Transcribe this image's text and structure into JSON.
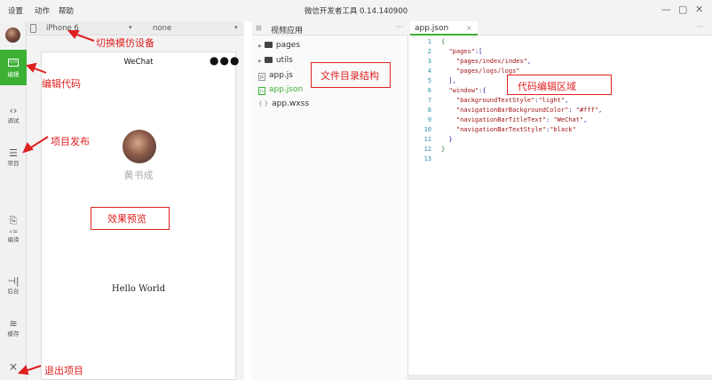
{
  "titlebar": {
    "menus": [
      "设置",
      "动作",
      "帮助"
    ],
    "title": "微信开发者工具 0.14.140900",
    "controls": [
      "minimize-icon",
      "restore-icon",
      "close-icon"
    ]
  },
  "toolbar": {
    "items": [
      {
        "label": "编辑",
        "icon": "code-box-icon",
        "active": true
      },
      {
        "label": "调试",
        "icon": "debug-icon"
      },
      {
        "label": "项目",
        "icon": "project-list-icon"
      },
      {
        "label": "编译",
        "icon": "compile-icon"
      },
      {
        "label": "后台",
        "icon": "background-icon"
      },
      {
        "label": "缓存",
        "icon": "cache-icon"
      }
    ],
    "exit_icon": "×"
  },
  "simulator": {
    "device": "iPhone 6",
    "network": "none",
    "nav_title": "WeChat",
    "menu_dots": "●●●",
    "user_name": "黄书成",
    "hello_text": "Hello World"
  },
  "filetree": {
    "title": "视频应用",
    "more": "···",
    "items": [
      {
        "name": "pages",
        "type": "folder"
      },
      {
        "name": "utils",
        "type": "folder"
      },
      {
        "name": "app.js",
        "type": "file"
      },
      {
        "name": "app.json",
        "type": "file",
        "active": true
      },
      {
        "name": "app.wxss",
        "type": "file"
      }
    ]
  },
  "editor": {
    "tab": "app.json",
    "tab_close": "×",
    "more": "···",
    "line_numbers": [
      "1",
      "2",
      "3",
      "4",
      "5",
      "6",
      "7",
      "8",
      "9",
      "10",
      "11",
      "12",
      "13"
    ]
  },
  "annotations": {
    "switch_device": "切换模仿设备",
    "edit_code": "编辑代码",
    "publish": "项目发布",
    "preview": "效果预览",
    "file_structure": "文件目录结构",
    "code_area": "代码编辑区域",
    "exit": "退出项目"
  },
  "colors": {
    "accent_green": "#3cb035",
    "annotation_red": "#e02020"
  }
}
